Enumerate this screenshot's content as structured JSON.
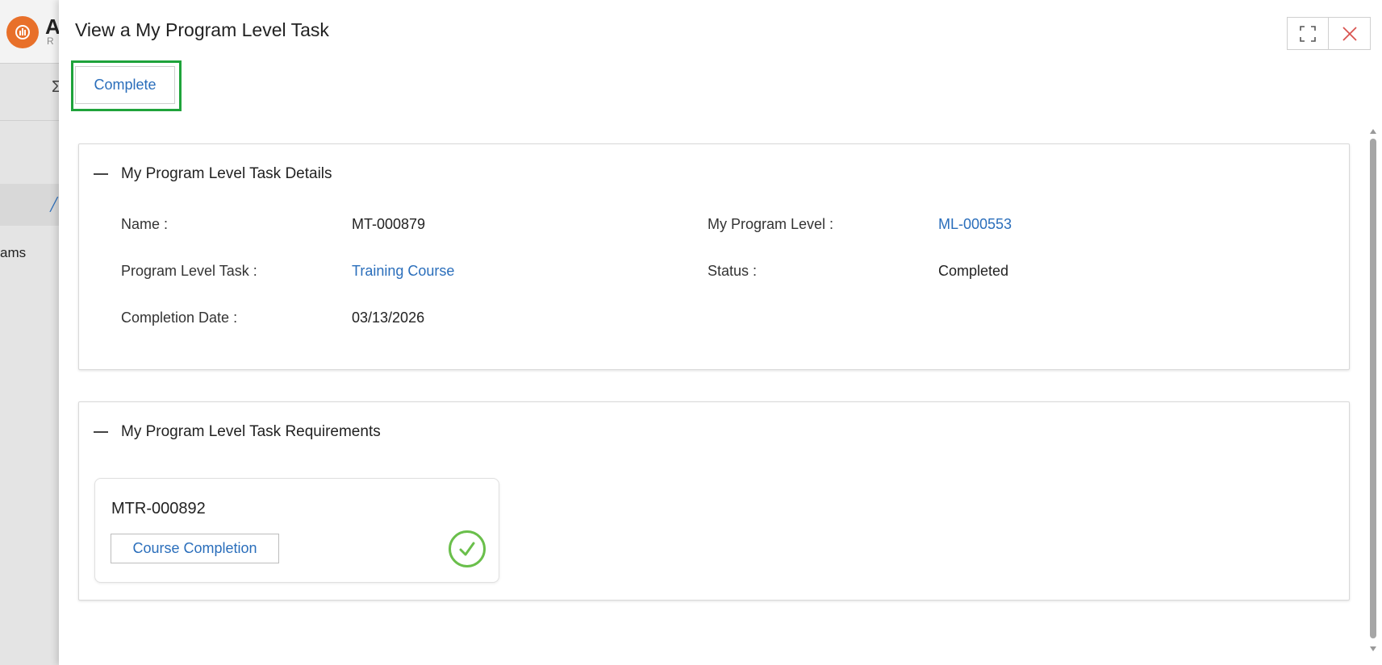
{
  "background": {
    "brand_letter": "A",
    "brand_sub": "R",
    "sigma_icon": "Σ",
    "nav_partial_label": "ams"
  },
  "modal": {
    "title": "View a My Program Level Task",
    "complete_label": "Complete",
    "expand_icon": "expand-icon",
    "close_icon": "close-icon"
  },
  "details": {
    "section_title": "My Program Level Task Details",
    "name_label": "Name :",
    "name_value": "MT-000879",
    "program_level_label": "My Program Level :",
    "program_level_value": "ML-000553",
    "task_label": "Program Level Task :",
    "task_value": "Training Course",
    "status_label": "Status :",
    "status_value": "Completed",
    "completion_label": "Completion Date :",
    "completion_value": "03/13/2026"
  },
  "requirements": {
    "section_title": "My Program Level Task Requirements",
    "items": [
      {
        "id": "MTR-000892",
        "button_label": "Course Completion",
        "status_icon": "check-circle-icon"
      }
    ]
  },
  "colors": {
    "link": "#2a6ebb",
    "highlight": "#1fa33b",
    "check": "#6abf4b",
    "logo": "#e8702a",
    "close_x": "#d9534f"
  }
}
